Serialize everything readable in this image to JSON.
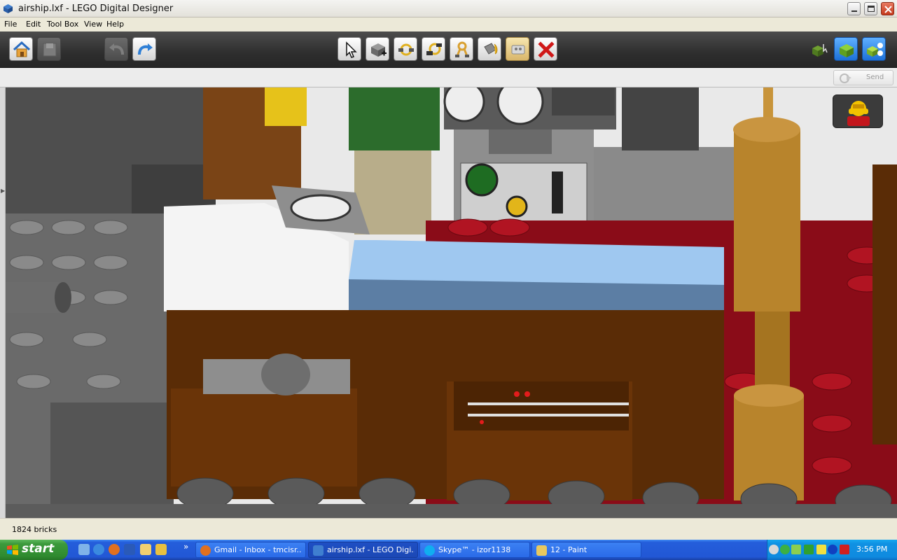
{
  "window": {
    "title": "airship.lxf - LEGO Digital Designer",
    "controls": [
      "minimize",
      "maximize",
      "close"
    ]
  },
  "menu": {
    "items": [
      {
        "label": "File"
      },
      {
        "label": "Edit"
      },
      {
        "label": "Tool Box"
      },
      {
        "label": "View"
      },
      {
        "label": "Help"
      }
    ]
  },
  "toolbar": {
    "left_buttons": [
      {
        "icon": "home-icon",
        "enabled": true
      },
      {
        "icon": "save-icon",
        "enabled": false
      },
      {
        "icon": "undo-icon",
        "enabled": false
      },
      {
        "icon": "redo-icon",
        "enabled": true
      }
    ],
    "center_tools": [
      {
        "icon": "select-cursor-icon"
      },
      {
        "icon": "clone-brick-icon"
      },
      {
        "icon": "hinge-tool-icon"
      },
      {
        "icon": "hinge-align-icon"
      },
      {
        "icon": "flex-tool-icon"
      },
      {
        "icon": "paint-bucket-icon"
      },
      {
        "icon": "hide-tool-icon",
        "active": true
      },
      {
        "icon": "delete-icon"
      }
    ],
    "right_modes": [
      {
        "icon": "build-mode-icon"
      },
      {
        "icon": "view-mode-icon"
      },
      {
        "icon": "building-guide-icon"
      }
    ]
  },
  "subbar": {
    "send_label": "Send"
  },
  "viewport": {
    "description_icon": "minifig-head-icon"
  },
  "status": {
    "brick_count": "1824 bricks"
  },
  "taskbar": {
    "start_label": "start",
    "quick_launch": [
      "show-desktop-icon",
      "ie-icon",
      "firefox-icon",
      "word-icon",
      "folder-icon",
      "notes-icon"
    ],
    "overflow": "»",
    "tasks": [
      {
        "label": "Gmail - Inbox - tmcisr...",
        "icon": "firefox-icon",
        "active": false
      },
      {
        "label": "airship.lxf - LEGO Digi...",
        "icon": "lego-icon",
        "active": true
      },
      {
        "label": "Skype™ - izor1138",
        "icon": "skype-icon",
        "active": false
      },
      {
        "label": "12 - Paint",
        "icon": "paint-icon",
        "active": false
      }
    ],
    "clock": "3:56 PM"
  },
  "colors": {
    "toolbar_bg": "#2e2e2e",
    "taskbar_blue": "#245edb",
    "start_green": "#3c9a3c",
    "tray_blue": "#0f8adf"
  }
}
